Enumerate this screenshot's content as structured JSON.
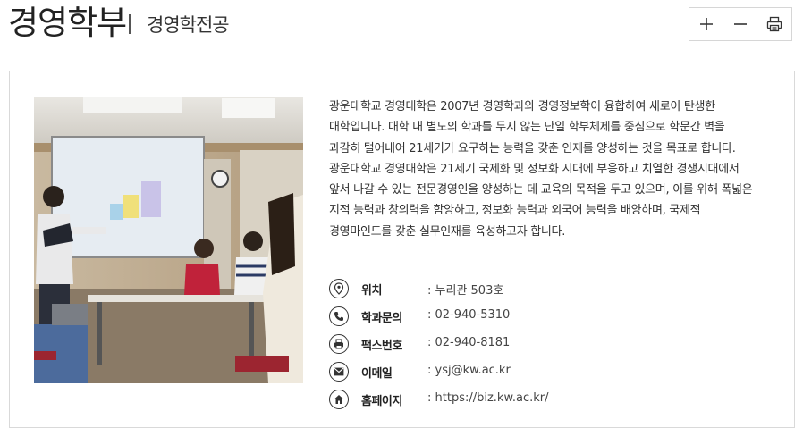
{
  "header": {
    "title": "경영학부",
    "subtitle": "경영학전공"
  },
  "toolbar": {
    "zoom_in_icon": "plus-icon",
    "zoom_out_icon": "minus-icon",
    "print_icon": "printer-icon"
  },
  "description": {
    "lines": [
      "광운대학교 경영대학은 2007년 경영학과와 경영정보학이 융합하여 새로이 탄생한",
      "대학입니다. 대학 내 별도의 학과를 두지 않는 단일 학부체제를 중심으로 학문간 벽을",
      "과감히 털어내어 21세기가 요구하는 능력을 갖춘 인재를 양성하는 것을 목표로 합니다.",
      "광운대학교 경영대학은 21세기 국제화 및 정보화 시대에 부응하고 치열한 경쟁시대에서",
      "앞서 나갈 수 있는 전문경영인을 양성하는 데 교육의 목적을 두고 있으며, 이를 위해 폭넓은",
      "지적 능력과 창의력을 함양하고, 정보화 능력과 외국어 능력을 배양하며, 국제적",
      "경영마인드를 갖춘 실무인재를 육성하고자 합니다."
    ]
  },
  "info": {
    "location": {
      "icon": "location-pin-icon",
      "label": "위치",
      "value": ": 누리관 503호"
    },
    "phone": {
      "icon": "phone-icon",
      "label": "학과문의",
      "value": ": 02-940-5310"
    },
    "fax": {
      "icon": "fax-icon",
      "label": "팩스번호",
      "value": ": 02-940-8181"
    },
    "email": {
      "icon": "mail-icon",
      "label": "이메일",
      "value": ": ysj@kw.ac.kr"
    },
    "homepage": {
      "icon": "home-icon",
      "label": "홈페이지",
      "value": ": https://biz.kw.ac.kr/"
    }
  }
}
